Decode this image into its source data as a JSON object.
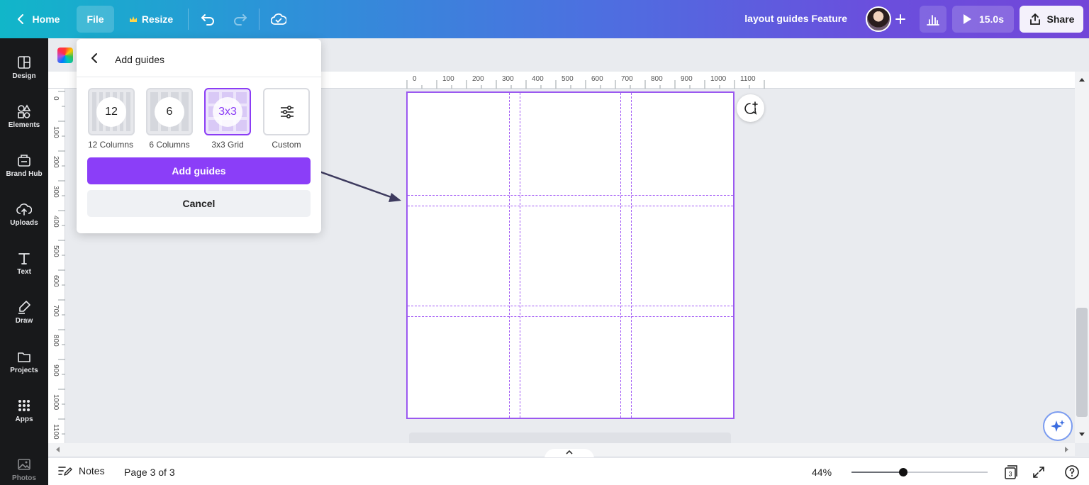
{
  "topbar": {
    "home_label": "Home",
    "file_label": "File",
    "resize_label": "Resize",
    "document_title": "layout guides Feature",
    "play_duration": "15.0s",
    "share_label": "Share",
    "icons": [
      "chevron-left-icon",
      "crown-icon",
      "undo-icon",
      "redo-icon",
      "cloud-check-icon",
      "plus-icon",
      "bar-chart-icon",
      "play-icon",
      "share-upload-icon"
    ]
  },
  "sidebar": {
    "items": [
      {
        "label": "Design",
        "icon": "layout-icon"
      },
      {
        "label": "Elements",
        "icon": "shapes-icon"
      },
      {
        "label": "Brand Hub",
        "icon": "brand-hub-icon"
      },
      {
        "label": "Uploads",
        "icon": "cloud-upload-icon"
      },
      {
        "label": "Text",
        "icon": "text-icon"
      },
      {
        "label": "Draw",
        "icon": "pen-icon"
      },
      {
        "label": "Projects",
        "icon": "folder-icon"
      },
      {
        "label": "Apps",
        "icon": "apps-grid-icon"
      },
      {
        "label": "Photos",
        "icon": "image-icon"
      }
    ]
  },
  "ruler": {
    "top_ticks": [
      "0",
      "100",
      "200",
      "300",
      "400",
      "500",
      "600",
      "700",
      "800",
      "900",
      "1000",
      "1100"
    ],
    "left_ticks": [
      "0",
      "100",
      "200",
      "300",
      "400",
      "500",
      "600",
      "700",
      "800",
      "900",
      "1000",
      "1100"
    ]
  },
  "panel": {
    "title": "Add guides",
    "options": [
      {
        "badge": "12",
        "label": "12 Columns",
        "selected": false
      },
      {
        "badge": "6",
        "label": "6 Columns",
        "selected": false
      },
      {
        "badge": "3x3",
        "label": "3x3 Grid",
        "selected": true
      },
      {
        "badge": "",
        "label": "Custom",
        "selected": false,
        "icon": "sliders-icon"
      }
    ],
    "primary_button": "Add guides",
    "secondary_button": "Cancel"
  },
  "bottombar": {
    "notes_label": "Notes",
    "page_indicator": "Page 3 of 3",
    "zoom_value": "44%",
    "zoom_fraction": 0.38,
    "page_count_badge": "3"
  },
  "colors": {
    "accent": "#8b3ef8",
    "guide": "#a259f5",
    "sidebar_bg": "#18191b"
  }
}
